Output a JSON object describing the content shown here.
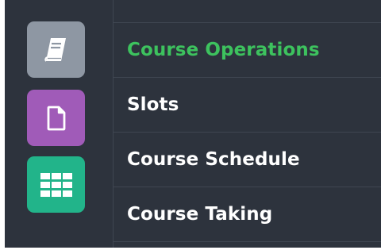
{
  "sidebar": {
    "tiles": [
      {
        "icon": "book-icon",
        "color": "#8e97a3"
      },
      {
        "icon": "document-icon",
        "color": "#a05bb8"
      },
      {
        "icon": "grid-icon",
        "color": "#22b48a"
      }
    ]
  },
  "menu": {
    "items": [
      {
        "label": "Course Operations",
        "active": true,
        "color": "#3dc25e"
      },
      {
        "label": "Slots",
        "active": false
      },
      {
        "label": "Course Schedule",
        "active": false
      },
      {
        "label": "Course Taking",
        "active": false
      }
    ]
  },
  "colors": {
    "background": "#2d333d",
    "divider": "#3f4651",
    "text": "#ffffff",
    "accent": "#3dc25e"
  }
}
